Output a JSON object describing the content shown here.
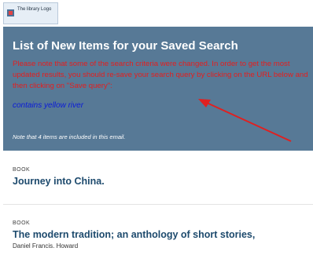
{
  "header": {
    "logo_text": "The library Logo"
  },
  "banner": {
    "title": "List of New Items for your Saved Search",
    "notice": "Please note that some of the search criteria were changed. In order to get the most updated results, you should re-save your search query by clicking on the URL below and then clicking on \"Save query\":",
    "query_link": "contains yellow river",
    "note": "Note that 4 items are included in this email."
  },
  "items": [
    {
      "type": "BOOK",
      "title": "Journey into China.",
      "author": ""
    },
    {
      "type": "BOOK",
      "title": "The modern tradition; an anthology of short stories,",
      "author": "Daniel Francis. Howard"
    }
  ],
  "colors": {
    "banner_bg": "#577996",
    "notice_text": "#e41e1e",
    "link_text": "#0a1ad8",
    "item_title": "#1d4a6d",
    "annotation_arrow": "#e02020"
  }
}
